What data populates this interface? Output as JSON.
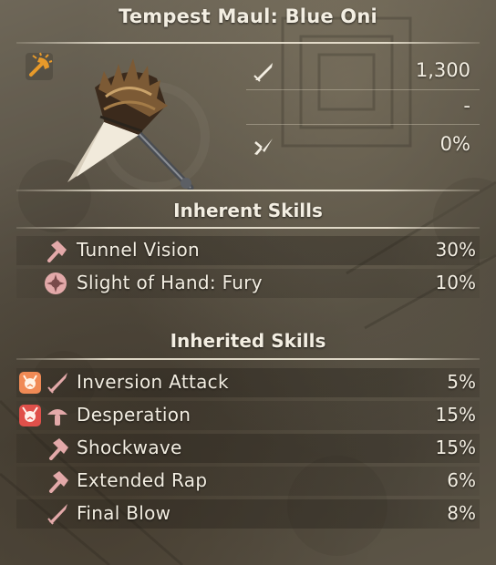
{
  "weapon": {
    "name": "Tempest Maul: Blue Oni",
    "type_icon": "maul-type-icon",
    "image": "tempest-maul-illustration"
  },
  "stats": [
    {
      "icon": "sword-attack-icon",
      "value": "1,300"
    },
    {
      "icon": "",
      "value": "-"
    },
    {
      "icon": "critical-slash-icon",
      "value": "0%"
    }
  ],
  "inherent_skills": {
    "header": "Inherent Skills",
    "items": [
      {
        "type_icon": "hammer-icon",
        "label": "Tunnel Vision",
        "value": "30%"
      },
      {
        "type_icon": "pinwheel-emblem-icon",
        "label": "Slight of Hand: Fury",
        "value": "10%"
      }
    ]
  },
  "inherited_skills": {
    "header": "Inherited Skills",
    "items": [
      {
        "source_icon": "oni-mask-icon",
        "type_icon": "sword-icon",
        "label": "Inversion Attack",
        "value": "5%"
      },
      {
        "source_icon": "oni-mask-red-icon",
        "type_icon": "mushroom-icon",
        "label": "Desperation",
        "value": "15%"
      },
      {
        "source_icon": "",
        "type_icon": "hammer-icon",
        "label": "Shockwave",
        "value": "15%"
      },
      {
        "source_icon": "",
        "type_icon": "hammer-icon",
        "label": "Extended Rap",
        "value": "6%"
      },
      {
        "source_icon": "",
        "type_icon": "sword-icon",
        "label": "Final Blow",
        "value": "8%"
      }
    ]
  },
  "colors": {
    "skill_icon": "#e3a9a9",
    "type_icon": "#e89a2a",
    "oni_mask": "#f08a55",
    "oni_mask_red": "#e0504a"
  }
}
